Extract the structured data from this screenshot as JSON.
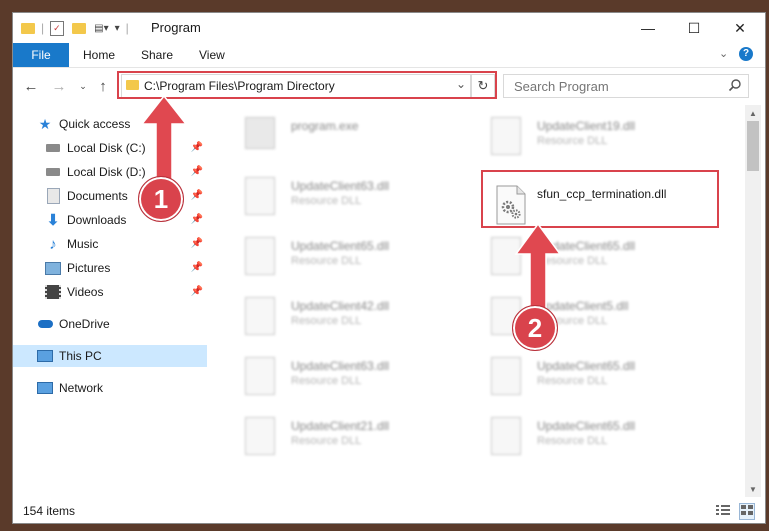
{
  "window": {
    "title": "Program",
    "minimize": "—",
    "maximize": "☐",
    "close": "✕"
  },
  "ribbon": {
    "tabs": [
      "File",
      "Home",
      "Share",
      "View"
    ]
  },
  "address": {
    "path": "C:\\Program Files\\Program Directory"
  },
  "search": {
    "placeholder": "Search Program"
  },
  "nav": {
    "quick_access": "Quick access",
    "items": [
      "Local Disk (C:)",
      "Local Disk (D:)",
      "Documents",
      "Downloads",
      "Music",
      "Pictures",
      "Videos"
    ],
    "onedrive": "OneDrive",
    "this_pc": "This PC",
    "network": "Network"
  },
  "files": {
    "left": [
      {
        "name": "program.exe",
        "type": ""
      },
      {
        "name": "UpdateClient63.dll",
        "type": "Resource DLL"
      },
      {
        "name": "UpdateClient65.dll",
        "type": "Resource DLL"
      },
      {
        "name": "UpdateClient42.dll",
        "type": "Resource DLL"
      },
      {
        "name": "UpdateClient63.dll",
        "type": "Resource DLL"
      },
      {
        "name": "UpdateClient21.dll",
        "type": "Resource DLL"
      }
    ],
    "right": [
      {
        "name": "UpdateClient19.dll",
        "type": "Resource DLL"
      },
      {
        "name": "UpdateClient65.dll",
        "type": "Resource DLL"
      },
      {
        "name": "UpdateClient5.dll",
        "type": "Resource DLL"
      },
      {
        "name": "UpdateClient65.dll",
        "type": "Resource DLL"
      },
      {
        "name": "UpdateClient65.dll",
        "type": "Resource DLL"
      }
    ],
    "highlighted": "sfun_ccp_termination.dll"
  },
  "status": {
    "count": "154 items"
  },
  "annotations": {
    "step1": "1",
    "step2": "2"
  },
  "colors": {
    "accent": "#1979ca",
    "highlight": "#d9434c",
    "selection": "#cce8ff"
  }
}
